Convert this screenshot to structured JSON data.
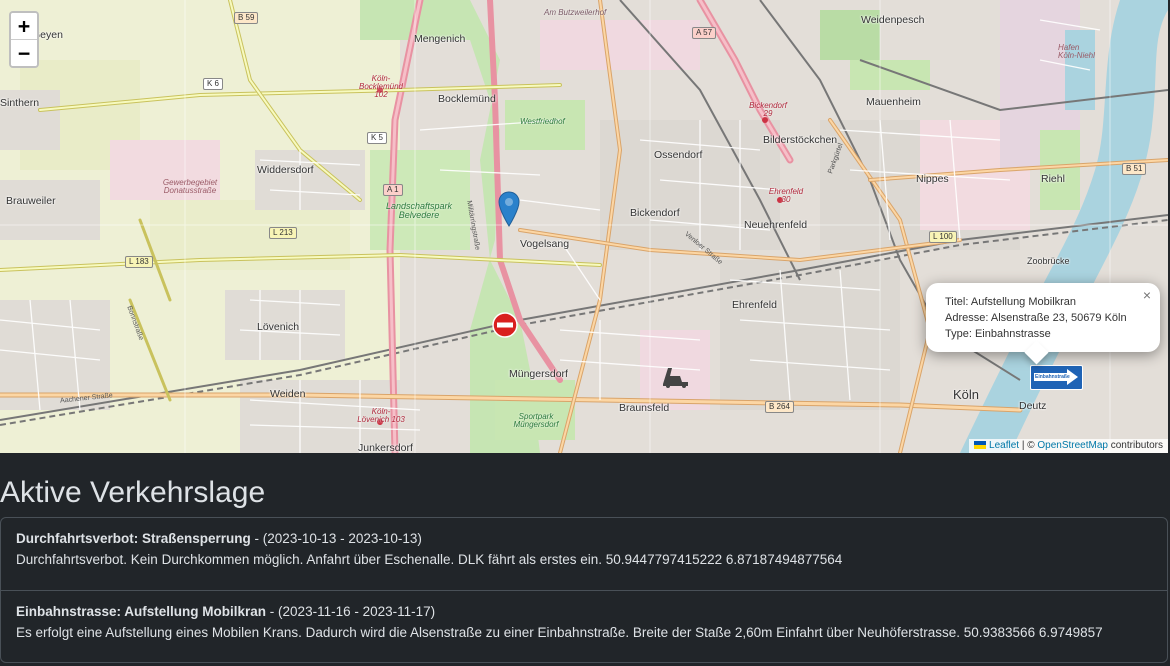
{
  "map": {
    "zoom_in": "+",
    "zoom_out": "−",
    "places": {
      "mengenich": "Mengenich",
      "weidenpesch": "Weidenpesch",
      "sinthern": "Sinthern",
      "geyen": "Geyen",
      "bocklemuend": "Bocklemünd",
      "mauenheim": "Mauenheim",
      "ossendorf": "Ossendorf",
      "bilderstoeckchen": "Bilderstöckchen",
      "widdersdorf": "Widdersdorf",
      "brauweiler": "Brauweiler",
      "nippes": "Nippes",
      "riehl": "Riehl",
      "bickendorf": "Bickendorf",
      "neuehrenfeld": "Neuehrenfeld",
      "vogelsang": "Vogelsang",
      "zoobruecke": "Zoobrücke",
      "ehrenfeld": "Ehrenfeld",
      "loevenich": "Lövenich",
      "muengersdorf": "Müngersdorf",
      "koeln": "Köln",
      "weiden": "Weiden",
      "braunsfeld": "Braunsfeld",
      "deutz": "Deutz",
      "junkersdorf": "Junkersdorf"
    },
    "parks": {
      "landschaftspark": "Landschaftspark Belvedere",
      "westfriedhof": "Westfriedhof",
      "sportpark": "Sportpark Müngersdorf",
      "gewerbegebiet": "Gewerbegebiet Donatusstraße",
      "hafen": "Hafen Köln-Niehl"
    },
    "stations": {
      "bocklemuend": "Köln-Bocklemünd 102",
      "bickendorf": "Bickendorf 29",
      "ehrenfeld": "Ehrenfeld 30",
      "loevenich": "Köln-Lövenich 103",
      "butzweiler": "Am Butzweilerhof"
    },
    "roads": {
      "b59": "B 59",
      "a57": "A 57",
      "k6": "K 6",
      "k5": "K 5",
      "a1": "A 1",
      "l213": "L 213",
      "l183": "L 183",
      "l100": "L 100",
      "b51": "B 51",
      "b264": "B 264",
      "militaer": "Militärringstraße",
      "aachener": "Aachener Straße",
      "venloer": "Venloer Straße",
      "bonnstr": "Bonnstraße",
      "parkguertel": "Parkgürtel",
      "oneway_sign": "Einbahnstraße"
    },
    "attribution": {
      "leaflet": "Leaflet",
      "separator": " | © ",
      "osm": "OpenStreetMap",
      "contributors": " contributors"
    },
    "popup": {
      "title": "Titel: Aufstellung Mobilkran",
      "address": "Adresse: Alsenstraße 23, 50679 Köln",
      "type": "Type: Einbahnstrasse",
      "close": "×"
    }
  },
  "heading": "Aktive Verkehrslage",
  "incidents": [
    {
      "title": "Durchfahrtsverbot: Straßensperrung",
      "dates": " - (2023-10-13 - 2023-10-13)",
      "description": "Durchfahrtsverbot. Kein Durchkommen möglich. Anfahrt über Eschenalle. DLK fährt als erstes ein. 50.9447797415222 6.87187494877564"
    },
    {
      "title": "Einbahnstrasse: Aufstellung Mobilkran",
      "dates": " - (2023-11-16 - 2023-11-17)",
      "description": "Es erfolgt eine Aufstellung eines Mobilen Krans. Dadurch wird die Alsenstraße zu einer Einbahnstraße. Breite der Staße 2,60m Einfahrt über Neuhöferstrasse. 50.9383566 6.9749857"
    }
  ]
}
